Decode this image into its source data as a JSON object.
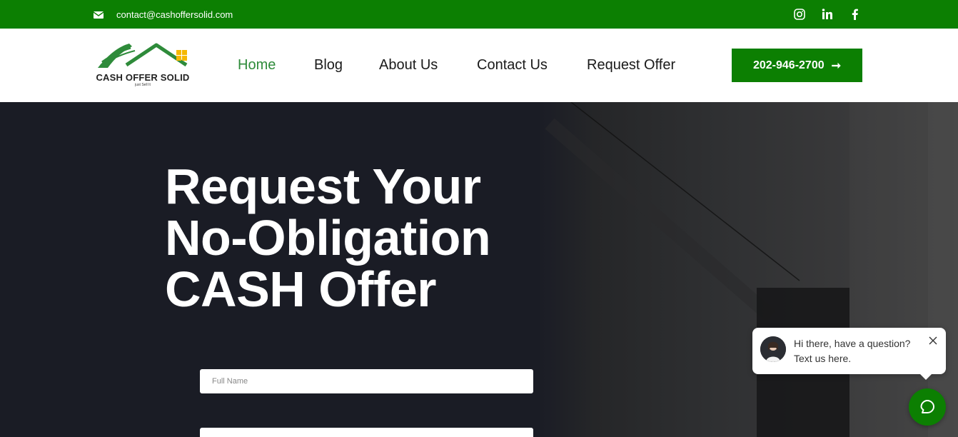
{
  "topbar": {
    "email": "contact@cashoffersolid.com",
    "icons": [
      "envelope-icon",
      "instagram-icon",
      "linkedin-icon",
      "facebook-icon"
    ],
    "bg_color": "#0c7f02"
  },
  "header": {
    "logo_text": "CASH OFFER SOLID",
    "logo_tagline": "just Sell It",
    "nav": [
      {
        "label": "Home",
        "active": true
      },
      {
        "label": "Blog"
      },
      {
        "label": "About Us"
      },
      {
        "label": "Contact Us"
      },
      {
        "label": "Request Offer"
      }
    ],
    "phone": "202-946-2700",
    "accent_color": "#0c7f02"
  },
  "hero": {
    "title_lines": [
      "Request Your",
      "No-Obligation",
      "CASH Offer"
    ],
    "form": {
      "full_name_placeholder": "Full Name"
    }
  },
  "chat": {
    "line1": "Hi there, have a question?",
    "line2": "Text us here."
  }
}
